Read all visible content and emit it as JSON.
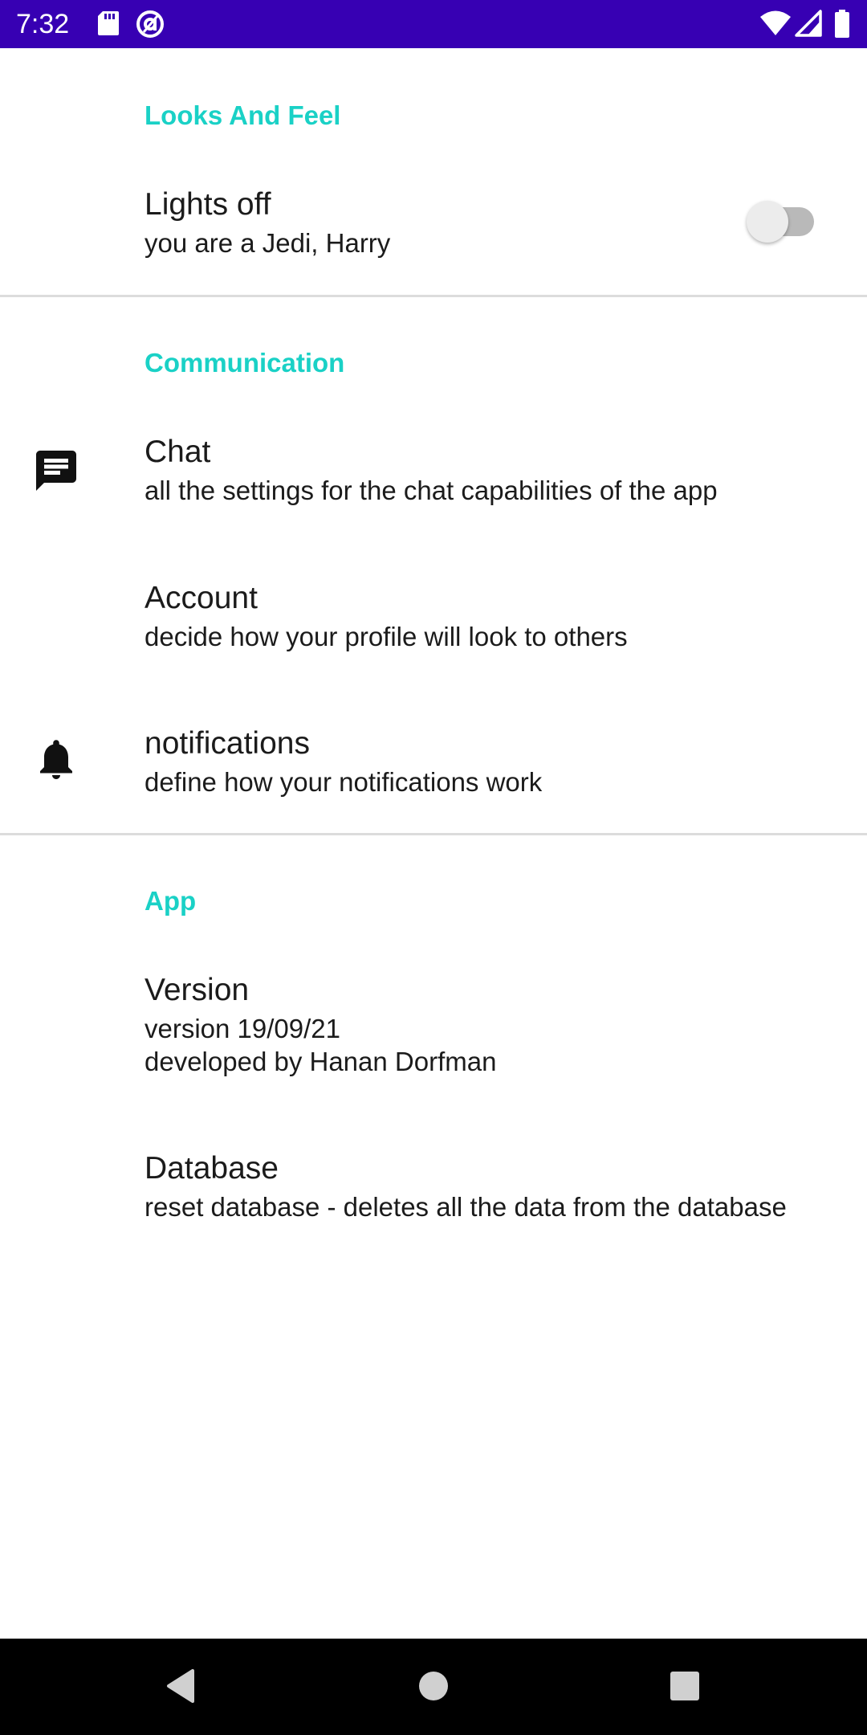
{
  "status_bar": {
    "time": "7:32",
    "icons": [
      "sd-card-icon",
      "circle-a-icon",
      "wifi-icon",
      "signal-icon",
      "battery-icon"
    ],
    "background": "#3700b3"
  },
  "accent_color": "#1ad1c6",
  "sections": {
    "looks": {
      "title": "Looks And Feel",
      "lights_off": {
        "title": "Lights off",
        "summary": "you are a Jedi, Harry",
        "switch_on": false
      }
    },
    "communication": {
      "title": "Communication",
      "chat": {
        "title": "Chat",
        "summary": "all the settings for the chat capabilities of the app",
        "icon": "chat-icon"
      },
      "account": {
        "title": "Account",
        "summary": "decide how your profile will look to others"
      },
      "notifications": {
        "title": "notifications",
        "summary": "define how your notifications work",
        "icon": "bell-icon"
      }
    },
    "app": {
      "title": "App",
      "version": {
        "title": "Version",
        "summary_line1": "version 19/09/21",
        "summary_line2": "developed by Hanan Dorfman"
      },
      "database": {
        "title": "Database",
        "summary": "reset database - deletes all the data from the database"
      }
    }
  },
  "nav_bar": {
    "buttons": [
      "back-icon",
      "home-icon",
      "recents-icon"
    ]
  }
}
